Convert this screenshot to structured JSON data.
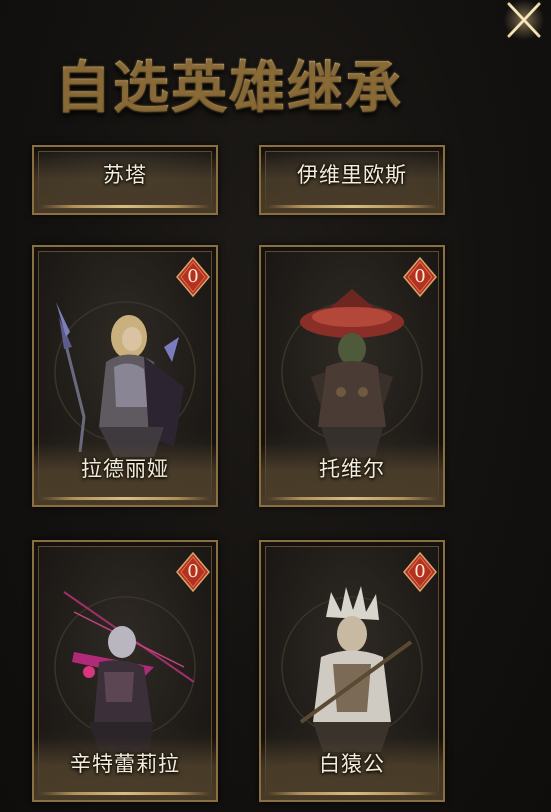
{
  "title": "自选英雄继承",
  "close_icon": "close-x-icon",
  "colors": {
    "background": "#141210",
    "frame_gold": "#8a6f41",
    "badge_red": "#c0341f",
    "title_gold": "#f1dcac"
  },
  "heroes": [
    {
      "name": "苏塔",
      "count": ""
    },
    {
      "name": "伊维里欧斯",
      "count": ""
    },
    {
      "name": "拉德丽娅",
      "count": "0"
    },
    {
      "name": "托维尔",
      "count": "0"
    },
    {
      "name": "辛特蕾莉拉",
      "count": "0"
    },
    {
      "name": "白猿公",
      "count": "0"
    }
  ]
}
